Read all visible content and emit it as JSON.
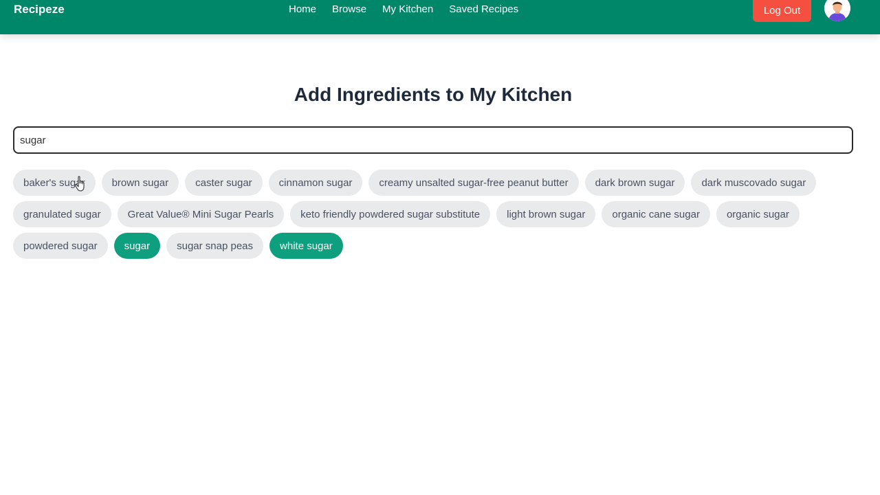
{
  "app": {
    "brand": "Recipeze"
  },
  "nav": {
    "links": [
      "Home",
      "Browse",
      "My Kitchen",
      "Saved Recipes"
    ],
    "logout_label": "Log Out"
  },
  "page": {
    "title": "Add Ingredients to My Kitchen"
  },
  "search": {
    "value": "sugar",
    "placeholder": ""
  },
  "suggestions": [
    {
      "label": "baker's sugar",
      "selected": false
    },
    {
      "label": "brown sugar",
      "selected": false
    },
    {
      "label": "caster sugar",
      "selected": false
    },
    {
      "label": "cinnamon sugar",
      "selected": false
    },
    {
      "label": "creamy unsalted sugar-free peanut butter",
      "selected": false
    },
    {
      "label": "dark brown sugar",
      "selected": false
    },
    {
      "label": "dark muscovado sugar",
      "selected": false
    },
    {
      "label": "granulated sugar",
      "selected": false
    },
    {
      "label": "Great Value® Mini Sugar Pearls",
      "selected": false
    },
    {
      "label": "keto friendly powdered sugar substitute",
      "selected": false
    },
    {
      "label": "light brown sugar",
      "selected": false
    },
    {
      "label": "organic cane sugar",
      "selected": false
    },
    {
      "label": "organic sugar",
      "selected": false
    },
    {
      "label": "powdered sugar",
      "selected": false
    },
    {
      "label": "sugar",
      "selected": true
    },
    {
      "label": "sugar snap peas",
      "selected": false
    },
    {
      "label": "white sugar",
      "selected": true
    }
  ],
  "colors": {
    "navbar": "#00876a",
    "logout": "#f5503f",
    "chip_selected": "#0ea07e",
    "chip_default": "#e9eaec"
  },
  "icons": {
    "avatar": "user-avatar-icon",
    "cursor": "hand-pointer-icon"
  }
}
